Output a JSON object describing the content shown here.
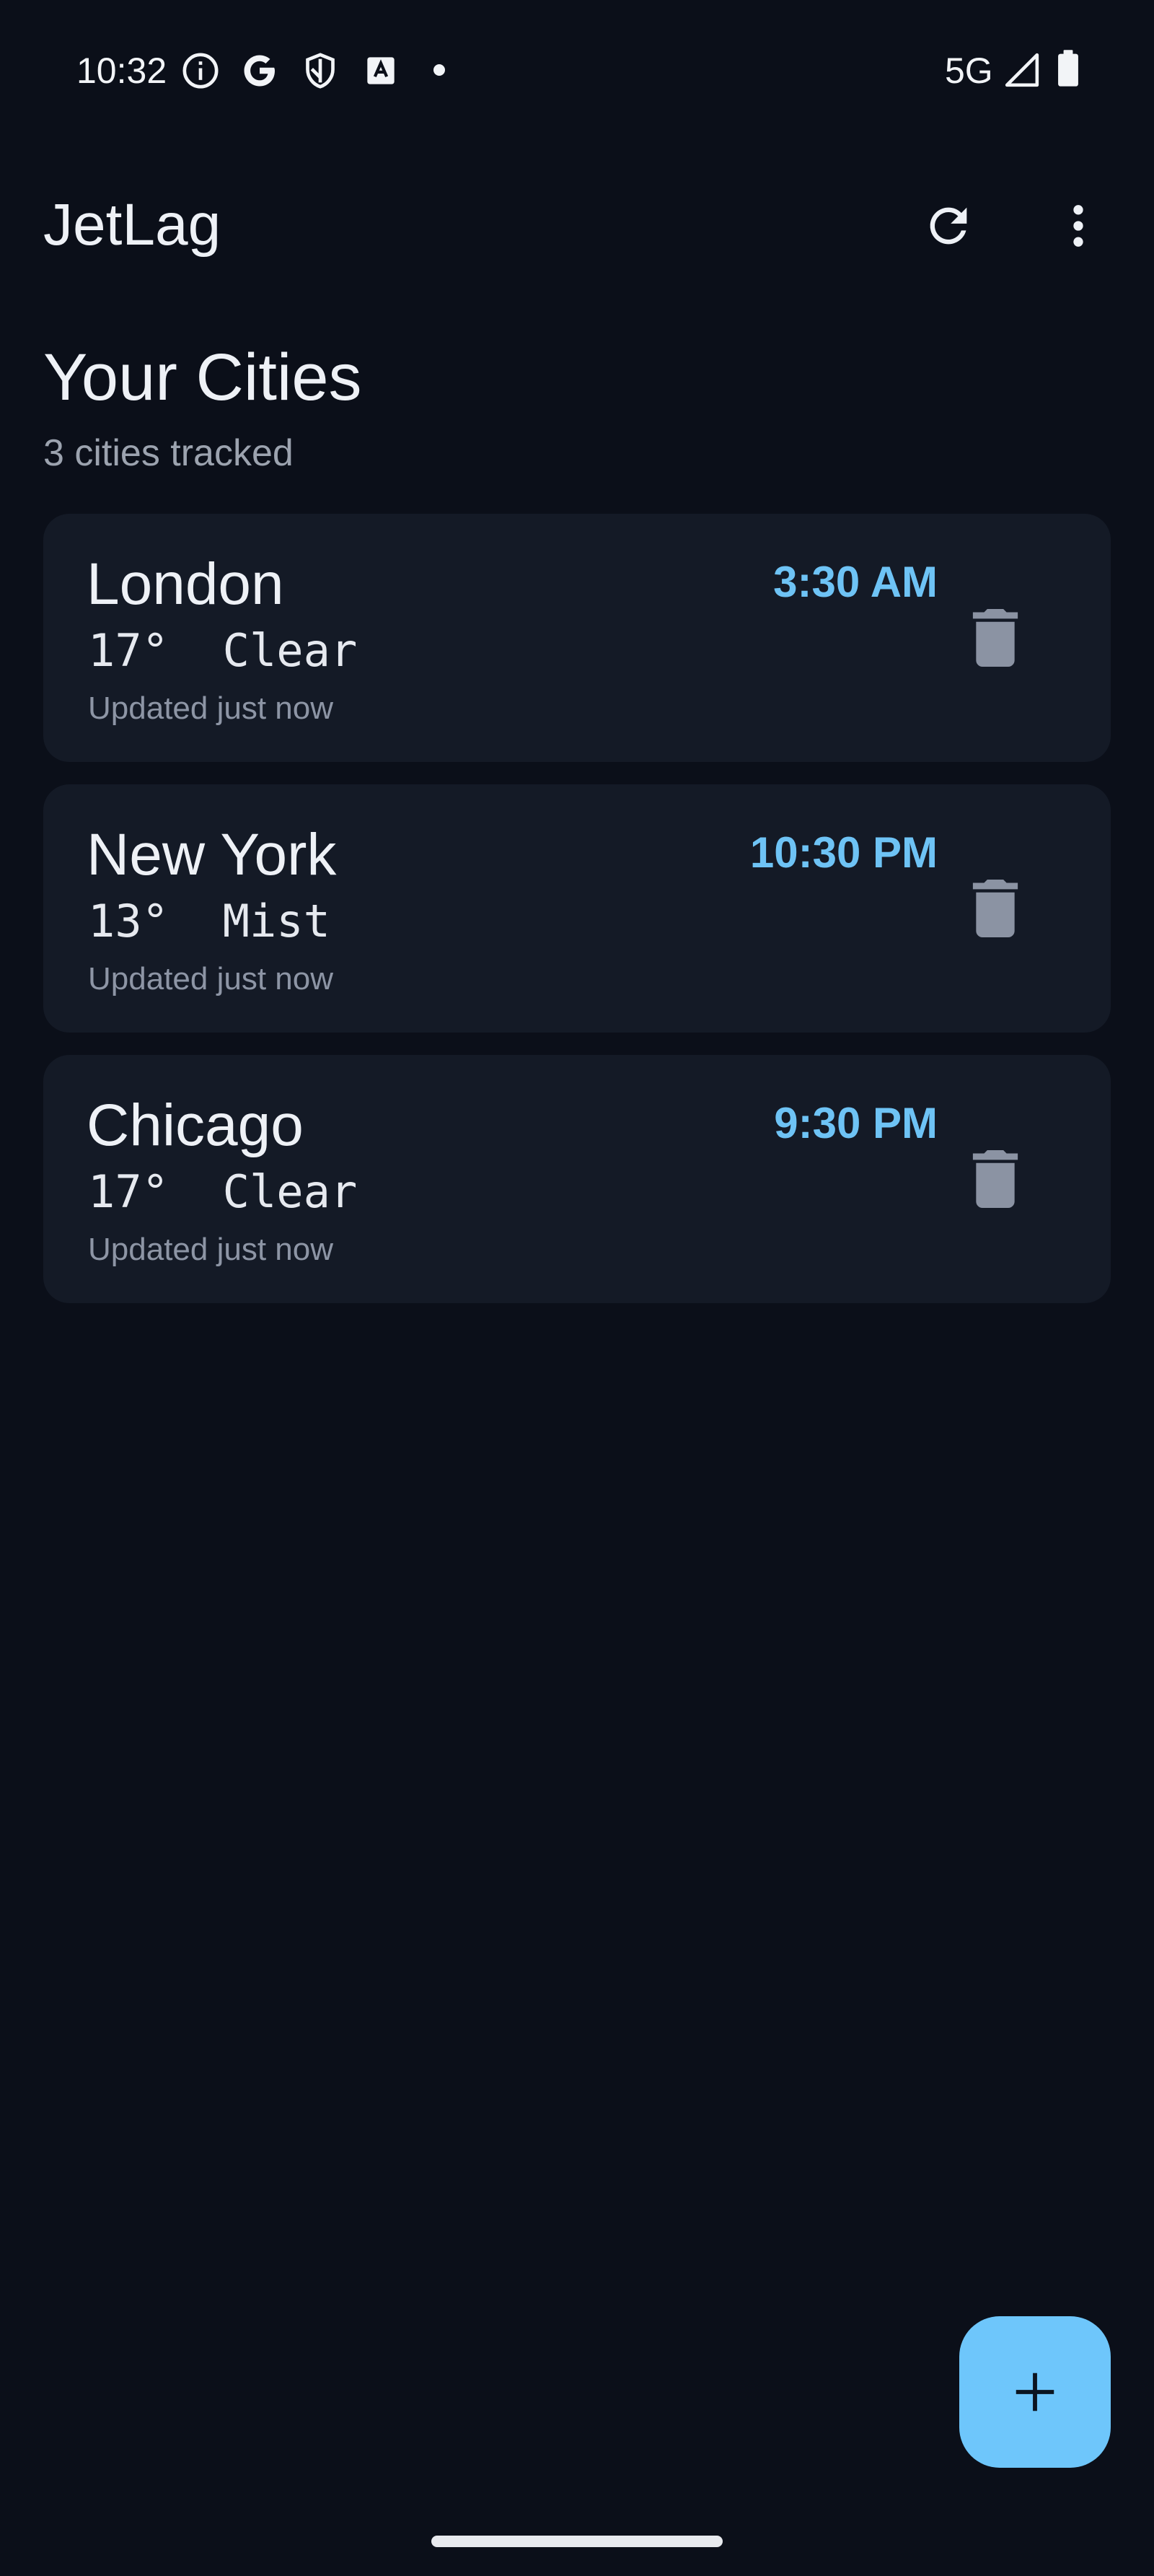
{
  "status_bar": {
    "time": "10:32",
    "network": "5G",
    "icons": [
      "info-icon",
      "google-icon",
      "shield-icon",
      "translate-icon",
      "notification-dot",
      "signal-icon",
      "battery-icon"
    ]
  },
  "app_bar": {
    "title": "JetLag",
    "actions": [
      "refresh-icon",
      "more-vert-icon"
    ]
  },
  "section": {
    "title": "Your Cities",
    "subtitle": "3 cities tracked"
  },
  "cities": [
    {
      "name": "London",
      "time": "3:30 AM",
      "weather": "17°  Clear",
      "updated": "Updated just now"
    },
    {
      "name": "New York",
      "time": "10:30 PM",
      "weather": "13°  Mist",
      "updated": "Updated just now"
    },
    {
      "name": "Chicago",
      "time": "9:30 PM",
      "weather": "17°  Clear",
      "updated": "Updated just now"
    }
  ],
  "fab": {
    "icon": "add-icon"
  },
  "colors": {
    "background": "#0b0f19",
    "card": "#141a26",
    "accent": "#6ec3f5",
    "fab": "#6ec6fb",
    "muted_text": "#9ca3af",
    "delete_icon": "#8b93a3"
  }
}
